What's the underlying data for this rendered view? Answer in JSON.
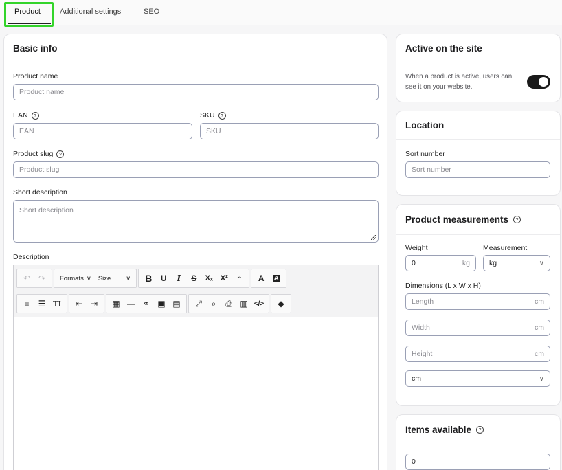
{
  "tabs": [
    {
      "label": "Product",
      "active": true
    },
    {
      "label": "Additional settings",
      "active": false
    },
    {
      "label": "SEO",
      "active": false
    }
  ],
  "basic_info": {
    "title": "Basic info",
    "product_name": {
      "label": "Product name",
      "placeholder": "Product name"
    },
    "ean": {
      "label": "EAN",
      "placeholder": "EAN"
    },
    "sku": {
      "label": "SKU",
      "placeholder": "SKU"
    },
    "product_slug": {
      "label": "Product slug",
      "placeholder": "Product slug"
    },
    "short_description": {
      "label": "Short description",
      "placeholder": "Short description"
    },
    "description": {
      "label": "Description"
    }
  },
  "editor_toolbar": {
    "formats_label": "Formats",
    "size_label": "Size",
    "row1": [
      "undo-icon",
      "redo-icon",
      "bold-icon",
      "underline-icon",
      "italic-icon",
      "strikethrough-icon",
      "subscript-icon",
      "superscript-icon",
      "blockquote-icon",
      "text-color-icon",
      "background-color-icon"
    ],
    "row2": [
      "align-icon",
      "ordered-list-icon",
      "text-transform-icon",
      "outdent-icon",
      "indent-icon",
      "table-icon",
      "horizontal-rule-icon",
      "link-icon",
      "image-icon",
      "media-icon",
      "fullscreen-icon",
      "search-replace-icon",
      "print-icon",
      "template-icon",
      "code-icon",
      "clear-format-icon"
    ]
  },
  "active_on_site": {
    "title": "Active on the site",
    "description": "When a product is active, users can see it on your website.",
    "enabled": true
  },
  "location": {
    "title": "Location",
    "sort_number": {
      "label": "Sort number",
      "placeholder": "Sort number"
    }
  },
  "measurements": {
    "title": "Product measurements",
    "weight": {
      "label": "Weight",
      "value": "0",
      "unit": "kg"
    },
    "measurement": {
      "label": "Measurement",
      "selected": "kg"
    },
    "dimensions_label": "Dimensions (L x W x H)",
    "length": {
      "placeholder": "Length",
      "unit": "cm"
    },
    "width": {
      "placeholder": "Width",
      "unit": "cm"
    },
    "height": {
      "placeholder": "Height",
      "unit": "cm"
    },
    "dimension_unit": {
      "selected": "cm"
    }
  },
  "items_available": {
    "title": "Items available",
    "value": "0"
  },
  "colors": {
    "tab_highlight": "#33d42a",
    "input_border": "#9aa0b5",
    "toggle_on": "#1a1a1a"
  }
}
